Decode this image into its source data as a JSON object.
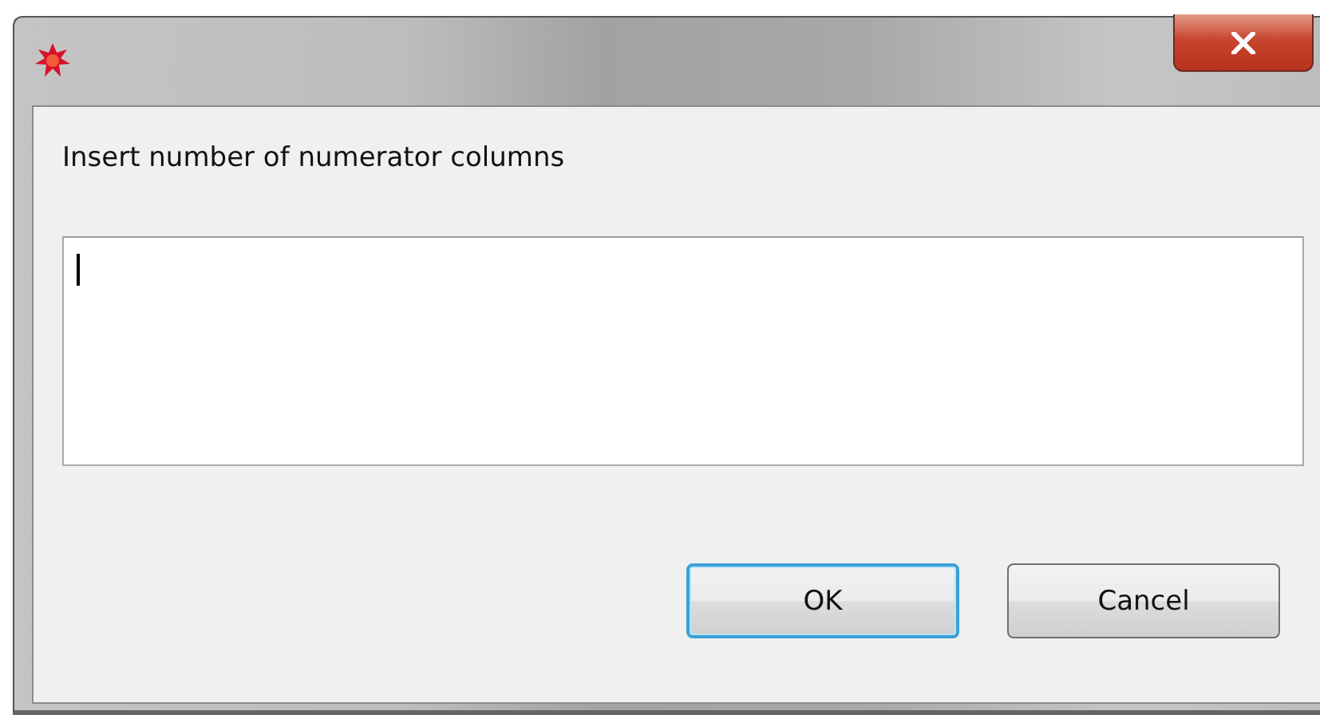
{
  "dialog": {
    "prompt": "Insert number of numerator columns",
    "field": {
      "focused": true
    },
    "buttons": [
      {
        "label": "OK",
        "default": true
      },
      {
        "label": "Cancel",
        "default": false
      }
    ]
  }
}
